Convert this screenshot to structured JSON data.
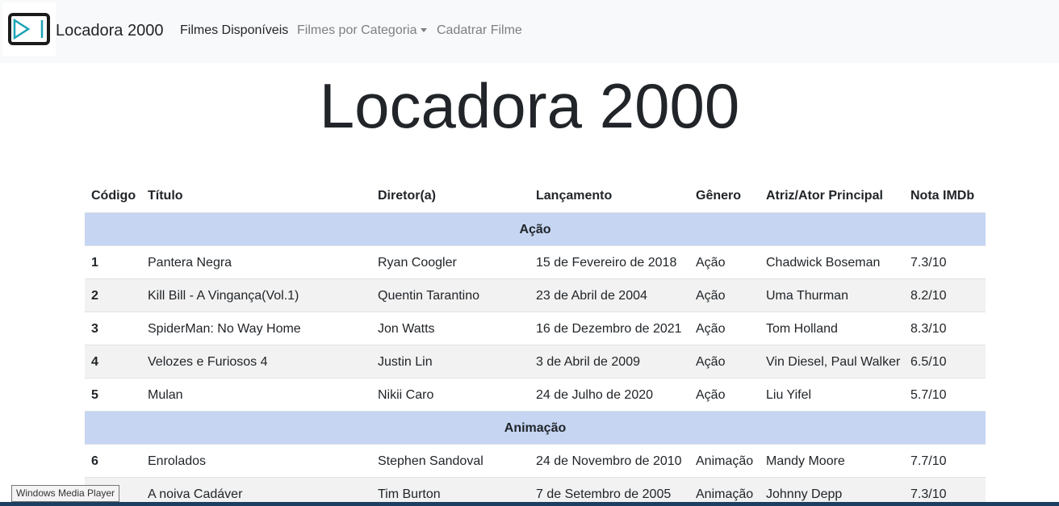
{
  "navbar": {
    "brand": "Locadora 2000",
    "links": [
      {
        "label": "Filmes Disponíveis"
      },
      {
        "label": "Filmes por Categoria"
      },
      {
        "label": "Cadatrar Filme"
      }
    ]
  },
  "heading": "Locadora 2000",
  "table": {
    "headers": [
      "Código",
      "Título",
      "Diretor(a)",
      "Lançamento",
      "Gênero",
      "Atriz/Ator Principal",
      "Nota IMDb"
    ],
    "groups": [
      {
        "category": "Ação",
        "rows": [
          [
            "1",
            "Pantera Negra",
            "Ryan Coogler",
            "15 de Fevereiro de 2018",
            "Ação",
            "Chadwick Boseman",
            "7.3/10"
          ],
          [
            "2",
            "Kill Bill - A Vingança(Vol.1)",
            "Quentin Tarantino",
            "23 de Abril de 2004",
            "Ação",
            "Uma Thurman",
            "8.2/10"
          ],
          [
            "3",
            "SpiderMan: No Way Home",
            "Jon Watts",
            "16 de Dezembro de 2021",
            "Ação",
            "Tom Holland",
            "8.3/10"
          ],
          [
            "4",
            "Velozes e Furiosos 4",
            "Justin Lin",
            "3 de Abril de 2009",
            "Ação",
            "Vin Diesel, Paul Walker",
            "6.5/10"
          ],
          [
            "5",
            "Mulan",
            "Nikii Caro",
            "24 de Julho de 2020",
            "Ação",
            "Liu Yifel",
            "5.7/10"
          ]
        ]
      },
      {
        "category": "Animação",
        "rows": [
          [
            "6",
            "Enrolados",
            "Stephen Sandoval",
            "24 de Novembro de 2010",
            "Animação",
            "Mandy Moore",
            "7.7/10"
          ],
          [
            "",
            "A noiva Cadáver",
            "Tim Burton",
            "7 de Setembro de 2005",
            "Animação",
            "Johnny Depp",
            "7.3/10"
          ]
        ]
      }
    ]
  },
  "tooltip": "Windows Media Player",
  "colors": {
    "navbar_bg": "#f8f9fa",
    "category_row_bg": "#c5d5f2",
    "striped_row_bg": "#f2f2f2",
    "logo_accent": "#1aa3b5"
  }
}
